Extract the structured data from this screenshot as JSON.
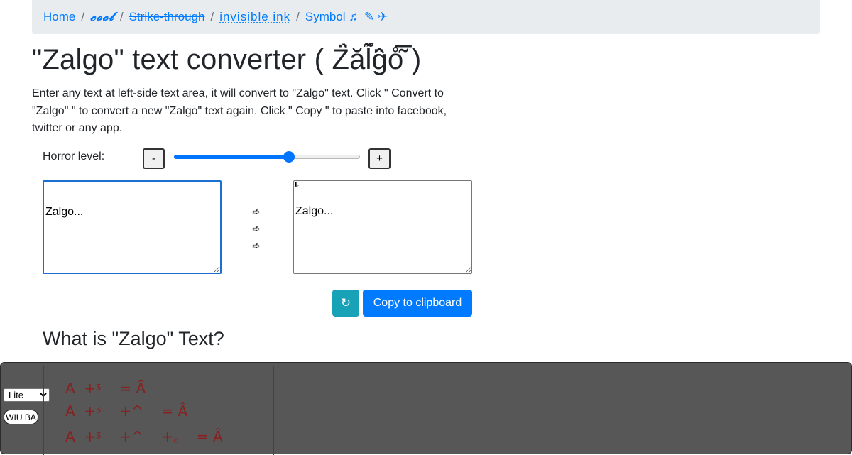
{
  "breadcrumb": {
    "items": [
      {
        "label": "Home"
      },
      {
        "label": "𝓬𝓸𝓸𝓵"
      },
      {
        "label": "Strike-through"
      },
      {
        "label": "invisible ink"
      },
      {
        "label": "Symbol ♬ ✎ ✈"
      }
    ],
    "separator": "/"
  },
  "page_title": "\"Zalgo\" text converter ( Z̈̀ăĺ̃ĝ̈o̊͂̅ )",
  "intro": "Enter any text at left-side text area, it will convert to \"Zalgo\" text. Click \" Convert to \"Zalgo\" \" to convert a new \"Zalgo\" text again. Click \" Copy \" to paste into facebook, twitter or any app.",
  "horror": {
    "label": "Horror level:",
    "minus_label": "-",
    "plus_label": "+",
    "level_fraction": 0.62
  },
  "input_text": "Zalgo...",
  "output_text": "Zalgo...",
  "output_noise": "̴̵̶̷̸̡̢̧̨̛̖̗̘̙̜̝̞̟̠̣̤̥̦̩̪̫̬̭̮̯̰̱̲̳̹̺̻̼͇͈͉͍͎̀́̂̃̄̅̆̇̈̉̊̋̌̍̎̏̐̑̒̓̔̽̾̿̀́͂̓̈́͆͊͋͌̕̚ͅ͏͓͔͕͖͙͚͐͑͒͗͛ͣͤͥͦͧͨͩͪͫͬͭͮͯ͘͜͟͢͝͞͠͡",
  "arrows": [
    "➪",
    "➪",
    "➪"
  ],
  "buttons": {
    "refresh_icon": "↻",
    "copy_label": "Copy to clipboard"
  },
  "section_heading": "What is \"Zalgo\" Text?",
  "overlay": {
    "select_value": "Lite",
    "button_label": "WIU BA",
    "demo_lines": [
      "A  +ᶾ    = Ȃ",
      "A  +ᶾ    +^    = Â",
      "A  +ᶾ    +^    +。  = Ȃ"
    ]
  }
}
